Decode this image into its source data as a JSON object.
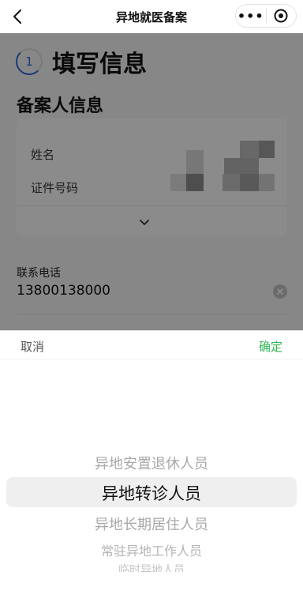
{
  "navbar": {
    "title": "异地就医备案",
    "back_icon": "chevron-left-icon",
    "more_icon": "more-dots-icon",
    "close_icon": "target-circle-icon",
    "more_glyph": "•••"
  },
  "form": {
    "step_number": "1",
    "step_title": "填写信息",
    "section_title": "备案人信息",
    "name_label": "姓名",
    "id_label": "证件号码",
    "expand_icon": "chevron-down-icon",
    "phone_label": "联系电话",
    "phone_value": "13800138000",
    "clear_icon": "clear-circle-icon"
  },
  "picker": {
    "cancel_label": "取消",
    "confirm_label": "确定",
    "selected_index": 1,
    "options": [
      "异地安置退休人员",
      "异地转诊人员",
      "异地长期居住人员",
      "常驻异地工作人员",
      "临时异地人员"
    ]
  },
  "colors": {
    "accent_blue": "#2f6ad8",
    "confirm_green": "#2fb552",
    "mask": "rgba(0,0,0,0.45)"
  }
}
